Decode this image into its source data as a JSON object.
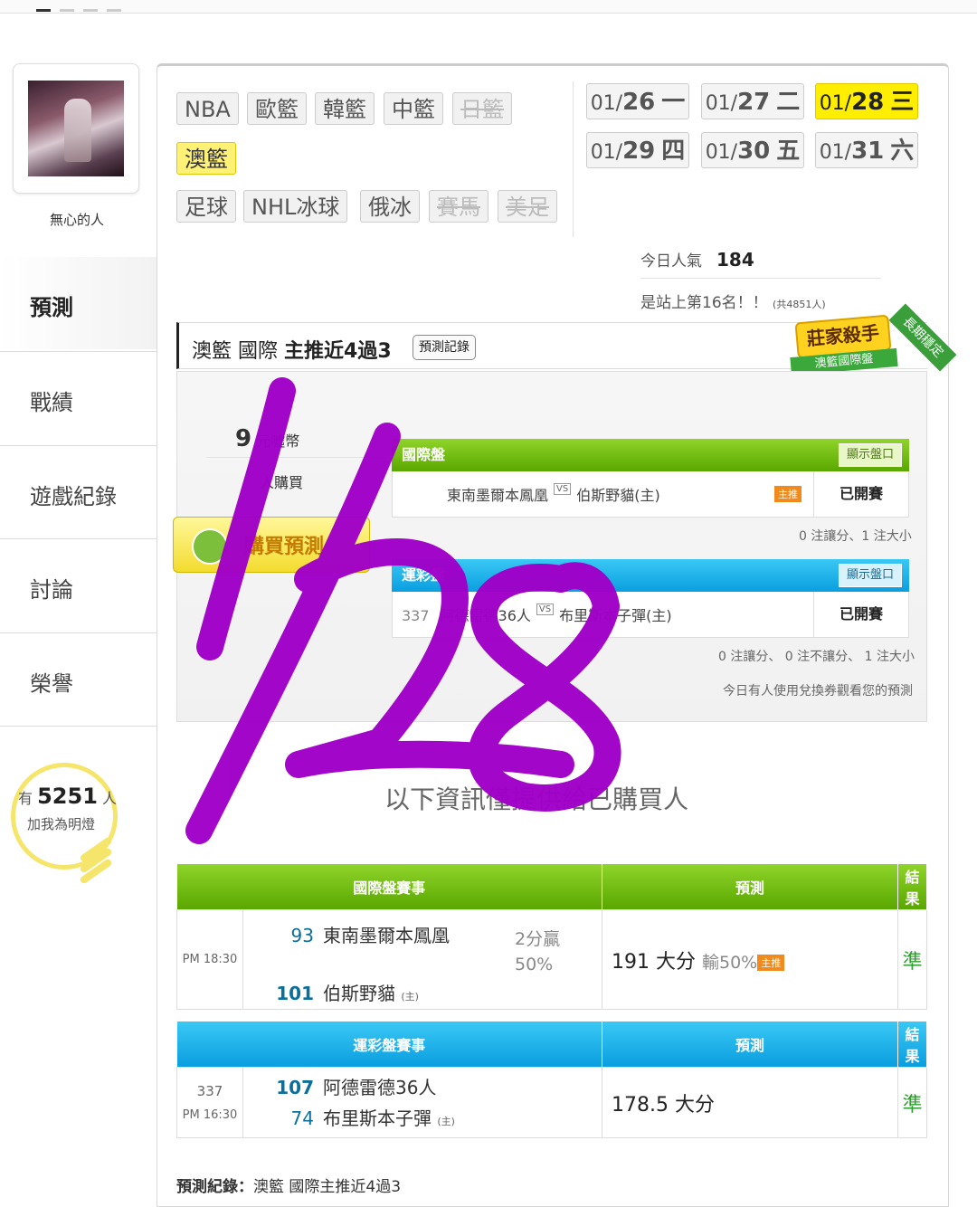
{
  "user": {
    "name": "無心的人"
  },
  "sidebar": {
    "items": [
      {
        "label": "預測"
      },
      {
        "label": "戰績"
      },
      {
        "label": "遊戲紀錄"
      },
      {
        "label": "討論"
      },
      {
        "label": "榮譽"
      }
    ],
    "lamp": {
      "prefix": "有",
      "count": "5251",
      "suffix": "人",
      "text": "加我為明燈"
    }
  },
  "leagues": {
    "row1": [
      "NBA",
      "歐籃",
      "韓籃",
      "中籃",
      "日籃"
    ],
    "row2": [
      "澳籃"
    ],
    "row3": [
      "足球",
      "NHL冰球",
      "俄冰",
      "賽馬",
      "美足"
    ]
  },
  "dates": [
    {
      "pre": "01/",
      "day": "26",
      "wd": "一"
    },
    {
      "pre": "01/",
      "day": "27",
      "wd": "二"
    },
    {
      "pre": "01/",
      "day": "28",
      "wd": "三"
    },
    {
      "pre": "01/",
      "day": "29",
      "wd": "四"
    },
    {
      "pre": "01/",
      "day": "30",
      "wd": "五"
    },
    {
      "pre": "01/",
      "day": "31",
      "wd": "六"
    }
  ],
  "popularity": {
    "label": "今日人氣",
    "value": "184",
    "rank_text": "是站上第16名！！",
    "total": "(共4851人)"
  },
  "prediction": {
    "league": "澳籃",
    "market": "國際",
    "record": "主推近4過3",
    "record_button": "預測記錄",
    "badge": "莊家殺手",
    "badge_sub": "澳籃國際盤",
    "ribbon": "長期穩定",
    "coin_value": "9",
    "coin_unit": "元噓幣",
    "buyers_text": "人購買",
    "buy_button": "購買預測"
  },
  "markets": {
    "intl": {
      "title": "國際盤",
      "show": "顯示盤口",
      "home": "東南墨爾本鳳凰",
      "vs": "VS",
      "away": "伯斯野貓(主)",
      "tag": "主推",
      "status": "已開賽",
      "note": "0 注讓分、1 注大小"
    },
    "lottery": {
      "title": "運彩盤",
      "show": "顯示盤口",
      "num": "337",
      "home": "阿德雷德36人",
      "vs": "VS",
      "away": "布里斯本子彈(主)",
      "status": "已開賽",
      "note": "0 注讓分、 0 注不讓分、 1 注大小"
    },
    "voucher_note": "今日有人使用兌換券觀看您的預測"
  },
  "info_text": "以下資訊僅提供給已購買人",
  "table_intl": {
    "headers": [
      "國際盤賽事",
      "預測",
      "結果"
    ],
    "time": "PM 18:30",
    "team1_num": "93",
    "team1": "東南墨爾本鳳凰",
    "team2_num": "101",
    "team2": "伯斯野貓",
    "home_mark": "(主)",
    "spread1": "2分贏",
    "spread2": "50%",
    "pred_main": "191 大分",
    "pred_sub": "輸50%",
    "tag": "主推",
    "result": "準"
  },
  "table_lottery": {
    "headers": [
      "運彩盤賽事",
      "預測",
      "結果"
    ],
    "game_no": "337",
    "time": "PM 16:30",
    "team1_num": "107",
    "team1": "阿德雷德36人",
    "team2_num": "74",
    "team2": "布里斯本子彈",
    "home_mark": "(主)",
    "pred_main": "178.5 大分",
    "result": "準"
  },
  "footer": {
    "label": "預測紀錄：",
    "text": "澳籃 國際主推近4過3"
  },
  "annotation": {
    "handwritten": "1/28",
    "color": "#a000c8"
  }
}
